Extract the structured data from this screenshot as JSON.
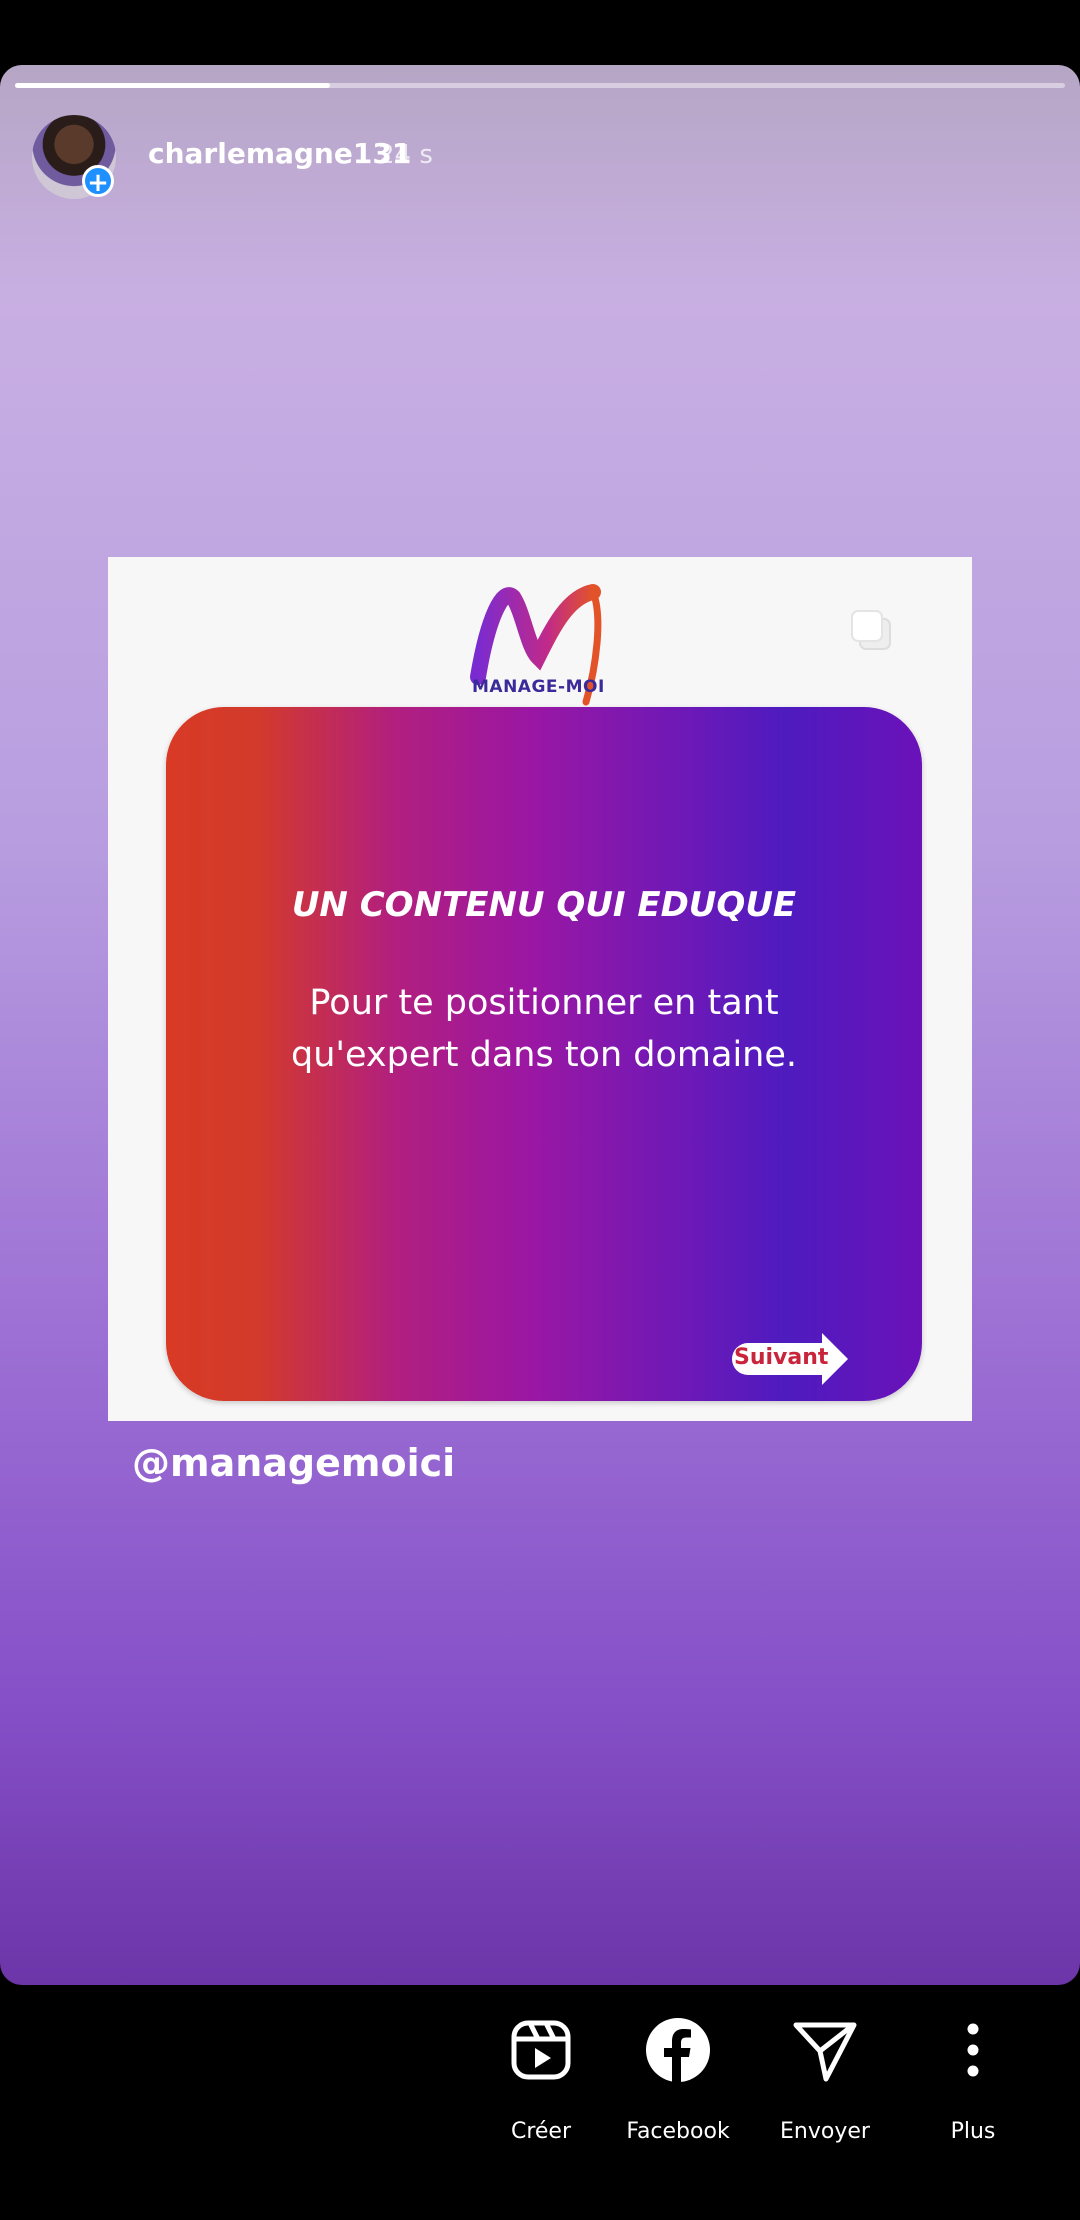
{
  "story": {
    "username": "charlemagne131",
    "time": "24 s",
    "progress": 0.3
  },
  "post": {
    "logo_text": "MANAGE-MOI",
    "card_title": "UN CONTENU QUI EDUQUE",
    "card_body": "Pour te positionner en tant qu'expert dans ton domaine.",
    "next_label": "Suivant"
  },
  "mention": "@managemoici",
  "actions": [
    {
      "label": "Créer",
      "icon": "reels-icon"
    },
    {
      "label": "Facebook",
      "icon": "facebook-icon"
    },
    {
      "label": "Envoyer",
      "icon": "send-icon"
    },
    {
      "label": "Plus",
      "icon": "more-vertical-icon"
    }
  ]
}
